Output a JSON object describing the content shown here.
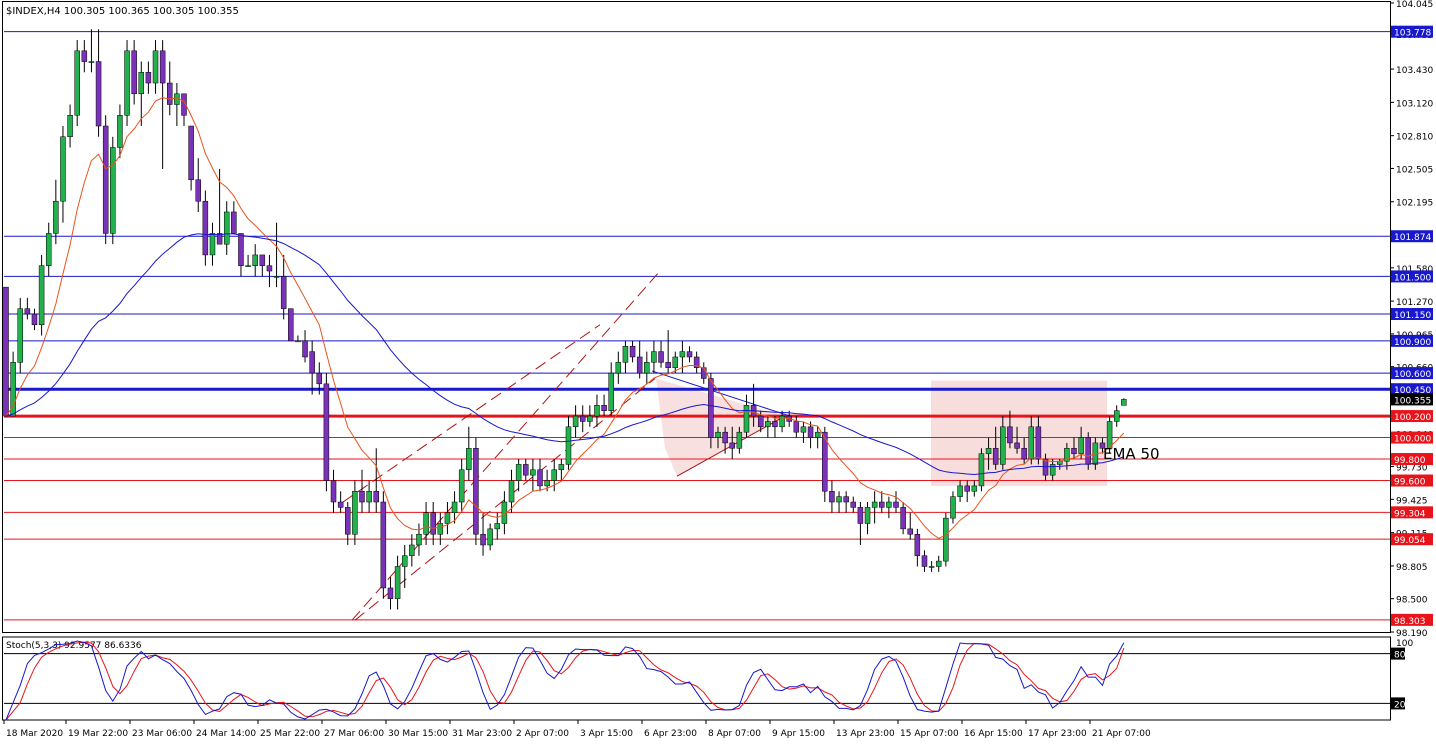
{
  "chart_data": {
    "type": "candlestick",
    "title": "$INDEX,H4  100.305 100.365 100.305 100.355",
    "y_ticks": [
      "104.045",
      "103.755",
      "103.430",
      "103.120",
      "102.810",
      "102.505",
      "102.195",
      "101.890",
      "101.580",
      "101.270",
      "100.965",
      "100.660",
      "100.350",
      "100.040",
      "99.730",
      "99.425",
      "99.115",
      "98.805",
      "98.500",
      "98.190"
    ],
    "ylim": [
      98.19,
      104.045
    ],
    "x_tick_labels": [
      "18 Mar 2020",
      "19 Mar 22:00",
      "23 Mar 06:00",
      "24 Mar 14:00",
      "25 Mar 22:00",
      "27 Mar 06:00",
      "30 Mar 15:00",
      "31 Mar 23:00",
      "2 Apr 07:00",
      "3 Apr 15:00",
      "6 Apr 23:00",
      "8 Apr 07:00",
      "9 Apr 15:00",
      "13 Apr 23:00",
      "15 Apr 07:00",
      "16 Apr 15:00",
      "17 Apr 23:00",
      "21 Apr 07:00"
    ],
    "current_price": "100.355",
    "level_lines": [
      {
        "label": "103.778",
        "value": 103.778,
        "color": "#1818cc",
        "fill": "#1818cc",
        "thick": false
      },
      {
        "label": "101.874",
        "value": 101.874,
        "color": "#1818cc",
        "fill": "#1818cc",
        "thick": false
      },
      {
        "label": "101.500",
        "value": 101.5,
        "color": "#1818cc",
        "fill": "#1818cc",
        "thick": false
      },
      {
        "label": "101.150",
        "value": 101.15,
        "color": "#1818cc",
        "fill": "#1818cc",
        "thick": false
      },
      {
        "label": "100.900",
        "value": 100.9,
        "color": "#1818cc",
        "fill": "#1818cc",
        "thick": false
      },
      {
        "label": "100.600",
        "value": 100.6,
        "color": "#1818cc",
        "fill": "#1818cc",
        "thick": false
      },
      {
        "label": "100.450",
        "value": 100.45,
        "color": "#1818cc",
        "fill": "#1818cc",
        "thick": true
      },
      {
        "label": "100.200",
        "value": 100.2,
        "color": "#e8141c",
        "fill": "#e8141c",
        "thick": true
      },
      {
        "label": "100.000",
        "value": 100.0,
        "color": "#e8141c",
        "fill": "#e8141c",
        "thick": false
      },
      {
        "label": "99.800",
        "value": 99.8,
        "color": "#e8141c",
        "fill": "#e8141c",
        "thick": false
      },
      {
        "label": "99.600",
        "value": 99.6,
        "color": "#e8141c",
        "fill": "#e8141c",
        "thick": false
      },
      {
        "label": "99.304",
        "value": 99.304,
        "color": "#e8141c",
        "fill": "#e8141c",
        "thick": false
      },
      {
        "label": "99.054",
        "value": 99.054,
        "color": "#e8141c",
        "fill": "#e8141c",
        "thick": false
      },
      {
        "label": "98.303",
        "value": 98.303,
        "color": "#e8141c",
        "fill": "#e8141c",
        "thick": false
      }
    ],
    "ohlc": [
      [
        101.4,
        101.4,
        100.2,
        100.2
      ],
      [
        100.2,
        100.8,
        100.2,
        100.7
      ],
      [
        100.7,
        101.3,
        100.6,
        101.2
      ],
      [
        101.2,
        101.3,
        101.1,
        101.15
      ],
      [
        101.15,
        101.2,
        101.0,
        101.05
      ],
      [
        101.05,
        101.7,
        100.95,
        101.6
      ],
      [
        101.6,
        102.0,
        101.5,
        101.9
      ],
      [
        101.9,
        102.4,
        101.8,
        102.2
      ],
      [
        102.2,
        102.9,
        102.0,
        102.8
      ],
      [
        102.8,
        103.1,
        102.7,
        103.0
      ],
      [
        103.0,
        103.7,
        102.9,
        103.6
      ],
      [
        103.6,
        103.7,
        103.4,
        103.5
      ],
      [
        103.5,
        103.8,
        103.4,
        103.5
      ],
      [
        103.5,
        103.8,
        102.8,
        102.9
      ],
      [
        102.9,
        103.0,
        101.8,
        101.9
      ],
      [
        101.9,
        102.8,
        101.8,
        102.7
      ],
      [
        102.7,
        103.1,
        102.6,
        103.0
      ],
      [
        103.0,
        103.7,
        102.9,
        103.6
      ],
      [
        103.6,
        103.7,
        103.1,
        103.2
      ],
      [
        103.2,
        103.5,
        102.9,
        103.4
      ],
      [
        103.4,
        103.5,
        103.2,
        103.3
      ],
      [
        103.3,
        103.7,
        103.2,
        103.6
      ],
      [
        103.6,
        103.7,
        102.5,
        103.3
      ],
      [
        103.3,
        103.5,
        103.0,
        103.1
      ],
      [
        103.1,
        103.3,
        102.9,
        103.2
      ],
      [
        103.2,
        103.2,
        102.9,
        103.0
      ],
      [
        102.9,
        102.9,
        102.3,
        102.4
      ],
      [
        102.4,
        102.6,
        102.1,
        102.2
      ],
      [
        102.2,
        102.3,
        101.6,
        101.7
      ],
      [
        101.7,
        102.0,
        101.6,
        101.9
      ],
      [
        101.9,
        102.5,
        101.8,
        101.8
      ],
      [
        101.8,
        102.2,
        101.7,
        102.1
      ],
      [
        102.1,
        102.2,
        101.9,
        101.9
      ],
      [
        101.9,
        101.9,
        101.5,
        101.6
      ],
      [
        101.6,
        101.7,
        101.6,
        101.6
      ],
      [
        101.6,
        101.8,
        101.5,
        101.7
      ],
      [
        101.7,
        101.7,
        101.5,
        101.6
      ],
      [
        101.6,
        101.7,
        101.4,
        101.55
      ],
      [
        101.5,
        102.0,
        101.4,
        101.5
      ],
      [
        101.5,
        101.7,
        101.1,
        101.2
      ],
      [
        101.2,
        101.0,
        100.9,
        100.9
      ],
      [
        100.9,
        100.95,
        100.9,
        100.9
      ],
      [
        100.9,
        101.0,
        100.7,
        100.75
      ],
      [
        100.8,
        100.9,
        100.4,
        100.6
      ],
      [
        100.6,
        100.7,
        100.4,
        100.5
      ],
      [
        100.5,
        100.6,
        99.5,
        99.6
      ],
      [
        99.6,
        99.7,
        99.3,
        99.4
      ],
      [
        99.4,
        99.5,
        99.3,
        99.35
      ],
      [
        99.35,
        99.4,
        99.0,
        99.1
      ],
      [
        99.1,
        99.6,
        99.0,
        99.5
      ],
      [
        99.5,
        99.7,
        99.3,
        99.4
      ],
      [
        99.4,
        99.6,
        99.3,
        99.5
      ],
      [
        99.5,
        99.9,
        99.3,
        99.4
      ],
      [
        99.4,
        99.5,
        98.5,
        98.6
      ],
      [
        98.6,
        98.7,
        98.4,
        98.5
      ],
      [
        98.5,
        98.9,
        98.4,
        98.8
      ],
      [
        98.8,
        99.0,
        98.6,
        98.9
      ],
      [
        98.9,
        99.1,
        98.8,
        99.0
      ],
      [
        99.0,
        99.2,
        98.9,
        99.1
      ],
      [
        99.1,
        99.4,
        99.0,
        99.3
      ],
      [
        99.3,
        99.4,
        99.0,
        99.1
      ],
      [
        99.1,
        99.3,
        99.0,
        99.2
      ],
      [
        99.2,
        99.4,
        99.1,
        99.3
      ],
      [
        99.3,
        99.5,
        99.2,
        99.4
      ],
      [
        99.4,
        99.8,
        99.3,
        99.7
      ],
      [
        99.7,
        100.1,
        99.6,
        99.9
      ],
      [
        99.9,
        100.0,
        99.0,
        99.1
      ],
      [
        99.1,
        99.3,
        98.9,
        99.0
      ],
      [
        99.0,
        99.2,
        98.95,
        99.15
      ],
      [
        99.15,
        99.3,
        99.05,
        99.2
      ],
      [
        99.2,
        99.5,
        99.1,
        99.4
      ],
      [
        99.4,
        99.7,
        99.3,
        99.6
      ],
      [
        99.6,
        99.8,
        99.5,
        99.75
      ],
      [
        99.75,
        99.8,
        99.6,
        99.65
      ],
      [
        99.65,
        99.8,
        99.5,
        99.7
      ],
      [
        99.7,
        99.8,
        99.5,
        99.55
      ],
      [
        99.55,
        99.7,
        99.5,
        99.6
      ],
      [
        99.6,
        99.8,
        99.5,
        99.7
      ],
      [
        99.7,
        99.8,
        99.6,
        99.75
      ],
      [
        99.75,
        100.2,
        99.7,
        100.1
      ],
      [
        100.1,
        100.3,
        100.0,
        100.2
      ],
      [
        100.2,
        100.3,
        100.05,
        100.15
      ],
      [
        100.15,
        100.3,
        100.1,
        100.2
      ],
      [
        100.2,
        100.4,
        100.1,
        100.3
      ],
      [
        100.3,
        100.4,
        100.2,
        100.25
      ],
      [
        100.25,
        100.7,
        100.2,
        100.6
      ],
      [
        100.6,
        100.8,
        100.5,
        100.7
      ],
      [
        100.7,
        100.9,
        100.6,
        100.85
      ],
      [
        100.85,
        100.9,
        100.7,
        100.75
      ],
      [
        100.75,
        100.9,
        100.55,
        100.6
      ],
      [
        100.6,
        100.8,
        100.5,
        100.7
      ],
      [
        100.7,
        100.9,
        100.6,
        100.8
      ],
      [
        100.8,
        100.9,
        100.65,
        100.7
      ],
      [
        100.7,
        101.0,
        100.6,
        100.65
      ],
      [
        100.65,
        100.8,
        100.6,
        100.75
      ],
      [
        100.75,
        100.9,
        100.6,
        100.8
      ],
      [
        100.8,
        100.85,
        100.7,
        100.75
      ],
      [
        100.75,
        100.8,
        100.6,
        100.65
      ],
      [
        100.65,
        100.7,
        100.5,
        100.55
      ],
      [
        100.55,
        100.6,
        99.9,
        100.0
      ],
      [
        100.0,
        100.1,
        99.9,
        100.05
      ],
      [
        100.05,
        100.1,
        99.85,
        99.95
      ],
      [
        99.95,
        100.1,
        99.8,
        99.9
      ],
      [
        99.9,
        100.1,
        99.85,
        100.05
      ],
      [
        100.05,
        100.4,
        100.0,
        100.3
      ],
      [
        100.3,
        100.5,
        100.1,
        100.2
      ],
      [
        100.2,
        100.25,
        100.05,
        100.1
      ],
      [
        100.1,
        100.2,
        100.0,
        100.15
      ],
      [
        100.15,
        100.2,
        100.0,
        100.1
      ],
      [
        100.1,
        100.25,
        100.05,
        100.2
      ],
      [
        100.2,
        100.25,
        100.1,
        100.15
      ],
      [
        100.15,
        100.2,
        100.0,
        100.05
      ],
      [
        100.05,
        100.15,
        99.95,
        100.1
      ],
      [
        100.1,
        100.15,
        99.9,
        100.0
      ],
      [
        100.0,
        100.1,
        99.9,
        100.05
      ],
      [
        100.05,
        100.1,
        99.4,
        99.5
      ],
      [
        99.5,
        99.6,
        99.3,
        99.4
      ],
      [
        99.4,
        99.5,
        99.3,
        99.45
      ],
      [
        99.45,
        99.5,
        99.3,
        99.4
      ],
      [
        99.4,
        99.45,
        99.3,
        99.35
      ],
      [
        99.35,
        99.4,
        99.0,
        99.2
      ],
      [
        99.2,
        99.4,
        99.1,
        99.35
      ],
      [
        99.35,
        99.5,
        99.2,
        99.4
      ],
      [
        99.4,
        99.5,
        99.3,
        99.35
      ],
      [
        99.35,
        99.45,
        99.25,
        99.4
      ],
      [
        99.4,
        99.5,
        99.3,
        99.35
      ],
      [
        99.35,
        99.4,
        99.1,
        99.15
      ],
      [
        99.15,
        99.3,
        99.05,
        99.1
      ],
      [
        99.1,
        99.15,
        98.8,
        98.9
      ],
      [
        98.9,
        98.95,
        98.75,
        98.8
      ],
      [
        98.8,
        98.85,
        98.75,
        98.8
      ],
      [
        98.8,
        98.9,
        98.75,
        98.85
      ],
      [
        98.85,
        99.3,
        98.8,
        99.25
      ],
      [
        99.25,
        99.5,
        99.2,
        99.45
      ],
      [
        99.45,
        99.6,
        99.4,
        99.55
      ],
      [
        99.55,
        99.6,
        99.4,
        99.5
      ],
      [
        99.5,
        99.6,
        99.45,
        99.55
      ],
      [
        99.55,
        99.9,
        99.5,
        99.85
      ],
      [
        99.85,
        100.0,
        99.7,
        99.9
      ],
      [
        99.9,
        100.1,
        99.7,
        99.75
      ],
      [
        99.75,
        100.2,
        99.7,
        100.1
      ],
      [
        100.1,
        100.25,
        99.9,
        99.95
      ],
      [
        99.95,
        100.1,
        99.85,
        99.9
      ],
      [
        99.9,
        100.0,
        99.75,
        99.8
      ],
      [
        99.8,
        100.2,
        99.75,
        100.1
      ],
      [
        100.1,
        100.2,
        99.75,
        99.8
      ],
      [
        99.8,
        99.85,
        99.6,
        99.65
      ],
      [
        99.65,
        99.8,
        99.6,
        99.75
      ],
      [
        99.75,
        99.8,
        99.7,
        99.78
      ],
      [
        99.78,
        99.95,
        99.7,
        99.9
      ],
      [
        99.9,
        100.0,
        99.8,
        99.85
      ],
      [
        99.85,
        100.1,
        99.8,
        100.0
      ],
      [
        100.0,
        100.05,
        99.7,
        99.75
      ],
      [
        99.75,
        100.0,
        99.7,
        99.95
      ],
      [
        99.95,
        100.0,
        99.85,
        99.9
      ],
      [
        99.9,
        100.2,
        99.85,
        100.15
      ],
      [
        100.15,
        100.3,
        100.1,
        100.25
      ],
      [
        100.3,
        100.365,
        100.3,
        100.355
      ]
    ],
    "ema_fast": "EMA 50",
    "stochastic": {
      "label": "Stoch(5,3,3) 92.9577 86.6336",
      "main": 92.9577,
      "signal": 86.6336,
      "levels": [
        "80",
        "20"
      ],
      "scale_top": "100"
    },
    "colors": {
      "bull": "#22b14c",
      "bear": "#7a33b8",
      "ema_fast": "#e8541c",
      "ema_slow": "#1818cc",
      "stoch_main": "#1818cc",
      "stoch_signal": "#e8141c",
      "zone": "#f4c6c6"
    }
  }
}
